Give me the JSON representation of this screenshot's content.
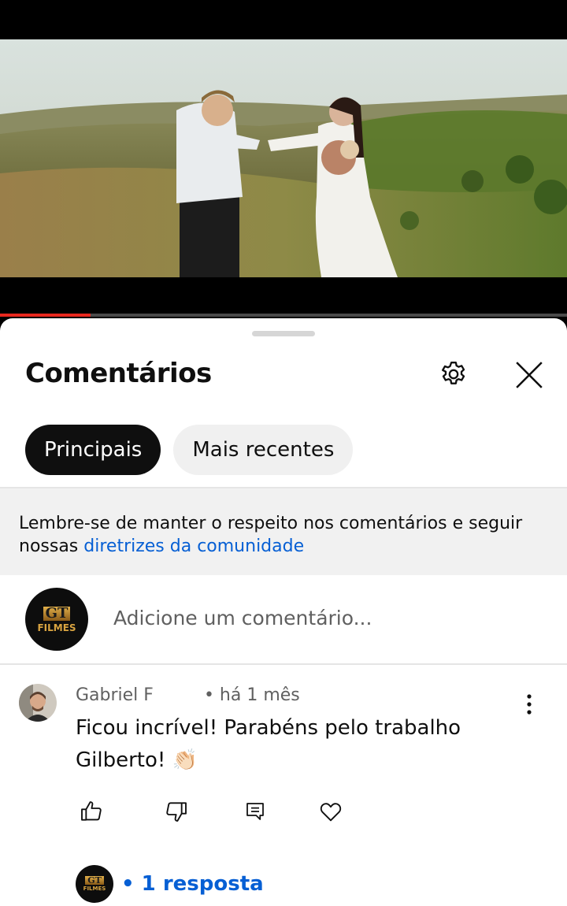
{
  "player": {
    "progress_fraction": 0.16
  },
  "sheet": {
    "title": "Comentários",
    "chips": [
      {
        "label": "Principais",
        "active": true
      },
      {
        "label": "Mais recentes",
        "active": false
      }
    ],
    "notice_text": "Lembre-se de manter o respeito nos comentários e seguir nossas ",
    "notice_link": "diretrizes da comunidade",
    "add_comment_placeholder": "Adicione um comentário...",
    "channel_logo": {
      "badge": "GT",
      "sub": "FILMES"
    }
  },
  "comment": {
    "author": "Gabriel F",
    "time": "• há 1 mês",
    "text": "Ficou incrível! Parabéns pelo trabalho Gilberto! 👏🏻",
    "replies_label": "• 1 resposta"
  },
  "colors": {
    "link": "#065fd4",
    "progress": "#e8281e",
    "chip_active": "#0f0f0f",
    "chip_inactive": "#f0f0f0"
  }
}
